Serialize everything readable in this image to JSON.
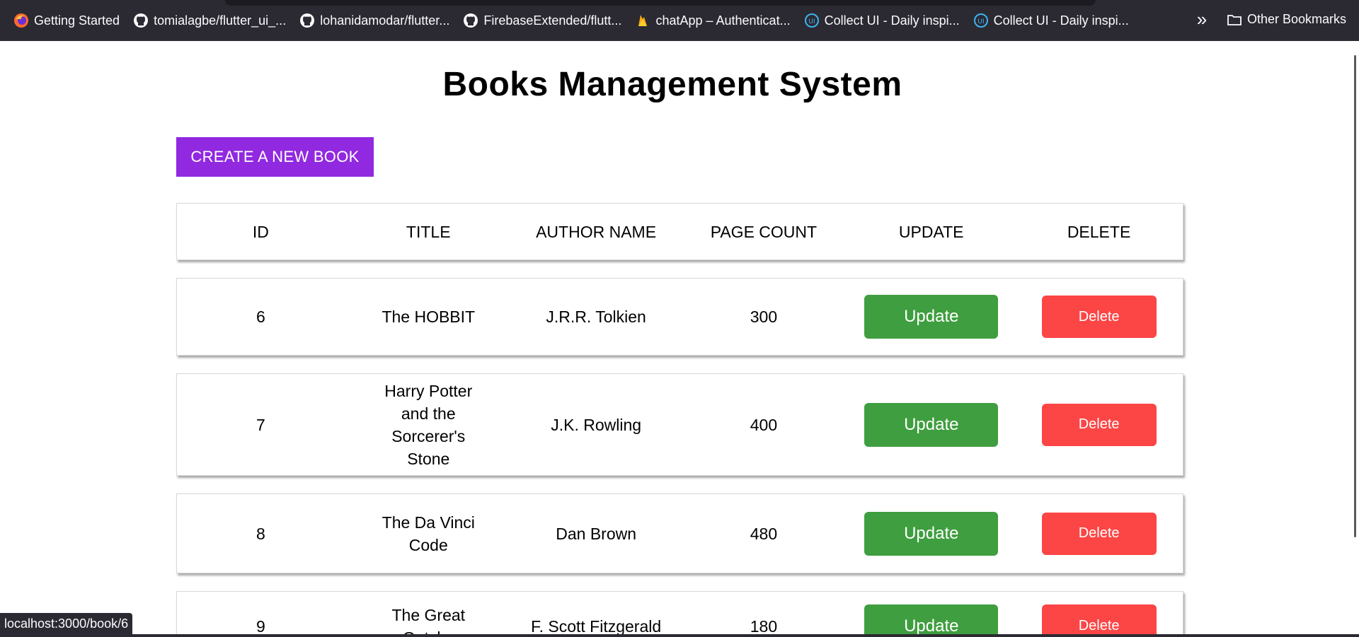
{
  "bookmarks": [
    {
      "label": "Getting Started",
      "icon": "firefox-icon"
    },
    {
      "label": "tomialagbe/flutter_ui_...",
      "icon": "github-icon"
    },
    {
      "label": "lohanidamodar/flutter...",
      "icon": "github-icon"
    },
    {
      "label": "FirebaseExtended/flutt...",
      "icon": "github-icon"
    },
    {
      "label": "chatApp – Authenticat...",
      "icon": "firebase-icon"
    },
    {
      "label": "Collect UI - Daily inspi...",
      "icon": "collectui-icon"
    },
    {
      "label": "Collect UI - Daily inspi...",
      "icon": "collectui-icon"
    }
  ],
  "other_bookmarks": "Other Bookmarks",
  "page": {
    "title": "Books Management System",
    "create_button": "CREATE A NEW BOOK"
  },
  "table": {
    "headers": [
      "ID",
      "TITLE",
      "AUTHOR NAME",
      "PAGE COUNT",
      "UPDATE",
      "DELETE"
    ],
    "rows": [
      {
        "id": "6",
        "title": "The HOBBIT",
        "author": "J.R.R. Tolkien",
        "pages": "300",
        "update": "Update",
        "delete": "Delete"
      },
      {
        "id": "7",
        "title": "Harry Potter and the Sorcerer's Stone",
        "author": "J.K. Rowling",
        "pages": "400",
        "update": "Update",
        "delete": "Delete"
      },
      {
        "id": "8",
        "title": "The Da Vinci Code",
        "author": "Dan Brown",
        "pages": "480",
        "update": "Update",
        "delete": "Delete"
      },
      {
        "id": "9",
        "title": "The Great Gatsby",
        "author": "F. Scott Fitzgerald",
        "pages": "180",
        "update": "Update",
        "delete": "Delete"
      }
    ]
  },
  "status_bar": {
    "url": "localhost:3000/book/6"
  },
  "colors": {
    "create": "#9129e0",
    "update": "#3f9e3f",
    "delete": "#fc4545",
    "bookmarks_bg": "#2b2a33"
  }
}
